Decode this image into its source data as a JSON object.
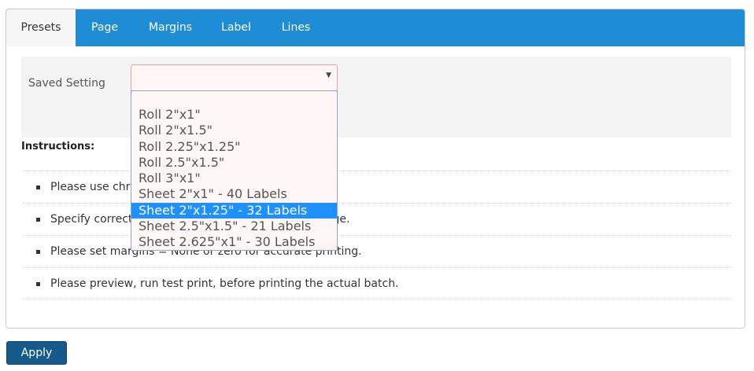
{
  "tabs": [
    {
      "label": "Presets"
    },
    {
      "label": "Page"
    },
    {
      "label": "Margins"
    },
    {
      "label": "Label"
    },
    {
      "label": "Lines"
    }
  ],
  "presets": {
    "saved_setting_label": "Saved Setting",
    "selected_value": "",
    "options": [
      "",
      "Roll 2\"x1\"",
      "Roll 2\"x1.5\"",
      "Roll 2.25\"x1.25\"",
      "Roll 2.5\"x1.5\"",
      "Roll 3\"x1\"",
      "Sheet 2\"x1\" - 40 Labels",
      "Sheet 2\"x1.25\" - 32 Labels",
      "Sheet 2.5\"x1.5\" - 21 Labels",
      "Sheet 2.625\"x1\" - 30 Labels"
    ],
    "highlighted_option": "Sheet 2\"x1.25\" - 32 Labels"
  },
  "instructions": {
    "title": "Instructions:",
    "items": [
      "Please use chrome browser for best printing results.",
      "Specify correct page size and orientation on the page.",
      "Please set margins = None or zero for accurate printing.",
      "Please preview, run test print, before printing the actual batch."
    ]
  },
  "apply_label": "Apply",
  "colors": {
    "tab_bar": "#1f8dd6",
    "apply_button": "#155a8a",
    "highlight": "#1e90ff"
  }
}
